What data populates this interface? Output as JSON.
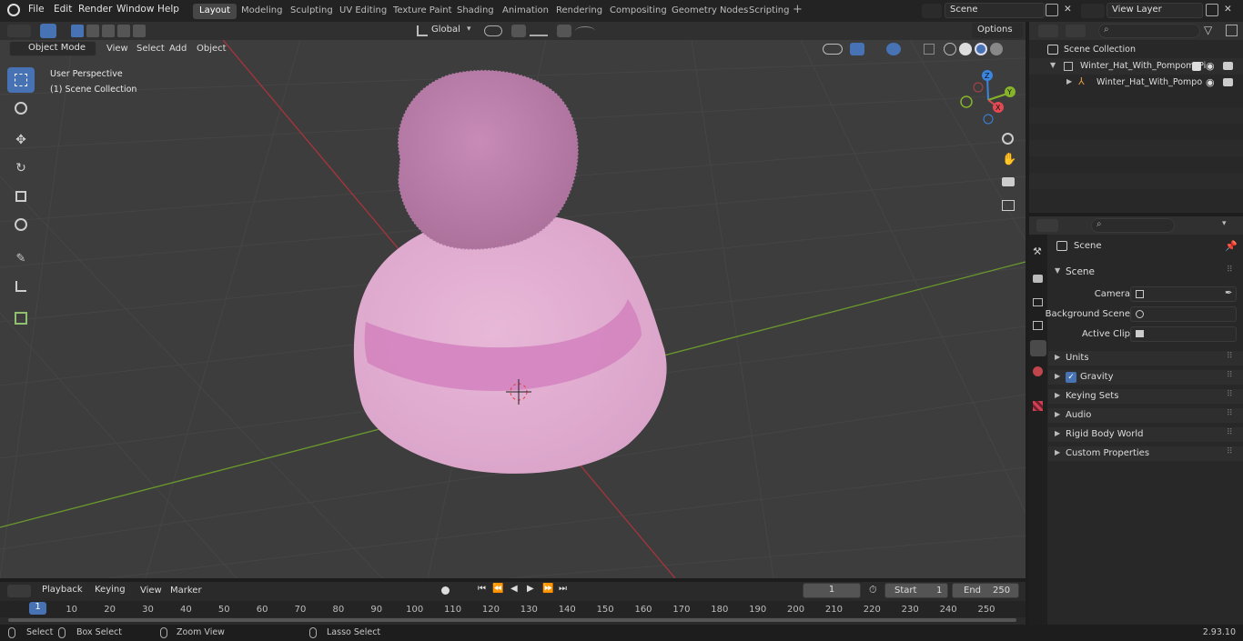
{
  "menubar": {
    "items": [
      "File",
      "Edit",
      "Render",
      "Window",
      "Help"
    ]
  },
  "workspaces": [
    "Layout",
    "Modeling",
    "Sculpting",
    "UV Editing",
    "Texture Paint",
    "Shading",
    "Animation",
    "Rendering",
    "Compositing",
    "Geometry Nodes",
    "Scripting"
  ],
  "active_workspace": "Layout",
  "scene_field": "Scene",
  "view_layer_field": "View Layer",
  "toolbar": {
    "transform_orientation": "Global",
    "options_label": "Options"
  },
  "header": {
    "mode": "Object Mode",
    "menus": [
      "View",
      "Select",
      "Add",
      "Object"
    ]
  },
  "viewport": {
    "perspective_label": "User Perspective",
    "collection_label": "(1) Scene Collection",
    "gizmo_axes": {
      "x": "X",
      "y": "Y",
      "z": "Z"
    }
  },
  "outliner": {
    "root": "Scene Collection",
    "items": [
      {
        "label": "Winter_Hat_With_Pompom_Pi"
      },
      {
        "label": "Winter_Hat_With_Pompo"
      }
    ]
  },
  "properties": {
    "context": "Scene",
    "panel_title": "Scene",
    "fields": [
      {
        "label": "Camera"
      },
      {
        "label": "Background Scene"
      },
      {
        "label": "Active Clip"
      }
    ],
    "subpanels": [
      "Units",
      "Gravity",
      "Keying Sets",
      "Audio",
      "Rigid Body World",
      "Custom Properties"
    ]
  },
  "timeline": {
    "menus": [
      "Playback",
      "Keying",
      "View",
      "Marker"
    ],
    "current_frame": "1",
    "start_label": "Start",
    "start_value": "1",
    "end_label": "End",
    "end_value": "250",
    "ticks": [
      "1",
      "10",
      "20",
      "30",
      "40",
      "50",
      "60",
      "70",
      "80",
      "90",
      "100",
      "110",
      "120",
      "130",
      "140",
      "150",
      "160",
      "170",
      "180",
      "190",
      "200",
      "210",
      "220",
      "230",
      "240",
      "250"
    ]
  },
  "statusbar": {
    "select": "Select",
    "box_select": "Box Select",
    "zoom_view": "Zoom View",
    "lasso_select": "Lasso Select",
    "version": "2.93.10"
  },
  "colors": {
    "accent": "#4772b3",
    "hat_body": "#e0aed0",
    "pompom": "#c286b2",
    "band": "#d484bf",
    "x_axis": "#a8343d",
    "y_axis": "#6a9a2c",
    "gizmo_x": "#e14a52",
    "gizmo_y": "#86b32a",
    "gizmo_z": "#3a85e0"
  }
}
